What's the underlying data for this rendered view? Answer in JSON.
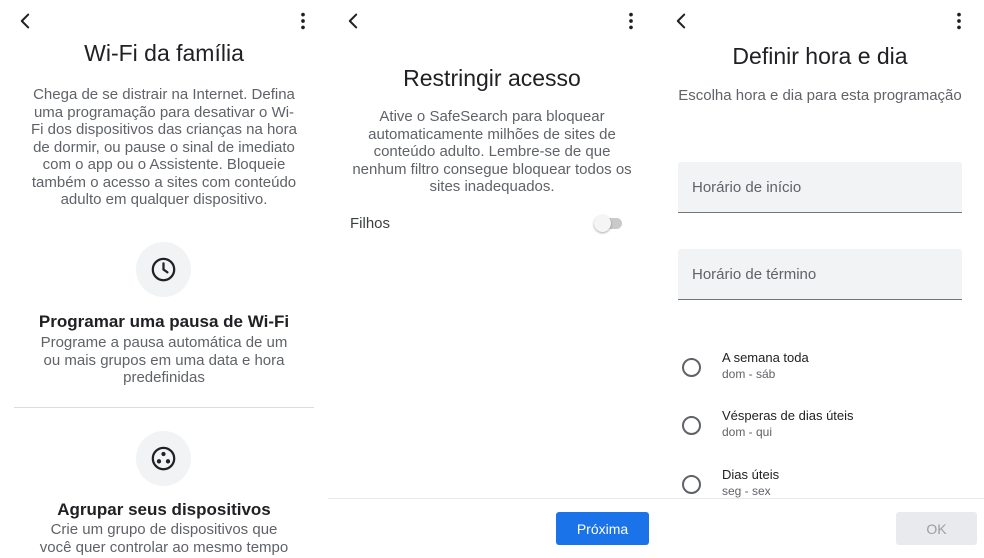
{
  "panel1": {
    "title": "Wi-Fi da família",
    "intro": "Chega de se distrair na Internet. Defina uma programação para desativar o Wi-Fi dos dispositivos das crianças na hora de dormir, ou pause o sinal de imediato com o app ou o Assistente. Bloqueie também o acesso a sites com conteúdo adulto em qualquer dispositivo.",
    "option1": {
      "icon": "clock-icon",
      "title": "Programar uma pausa de Wi-Fi",
      "desc": "Programe a pausa automática de um ou mais grupos em uma data e hora predefinidas"
    },
    "option2": {
      "icon": "devices-group-icon",
      "title": "Agrupar seus dispositivos",
      "desc": "Crie um grupo de dispositivos que você quer controlar ao mesmo tempo"
    }
  },
  "panel2": {
    "title": "Restringir acesso",
    "intro": "Ative o SafeSearch para bloquear automaticamente milhões de sites de conteúdo adulto. Lembre-se de que nenhum filtro consegue bloquear todos os sites inadequados.",
    "toggle_label": "Filhos",
    "toggle_on": false,
    "next_button": "Próxima"
  },
  "panel3": {
    "title": "Definir hora e dia",
    "subtitle": "Escolha hora e dia para esta programação",
    "start_placeholder": "Horário de início",
    "end_placeholder": "Horário de término",
    "options": [
      {
        "label": "A semana toda",
        "sub": "dom - sáb"
      },
      {
        "label": "Vésperas de dias úteis",
        "sub": "dom - qui"
      },
      {
        "label": "Dias úteis",
        "sub": "seg - sex"
      }
    ],
    "ok_button": "OK"
  },
  "colors": {
    "accent": "#1a73e8",
    "icon_bg": "#f1f3f4",
    "text_secondary": "#5f6368"
  }
}
